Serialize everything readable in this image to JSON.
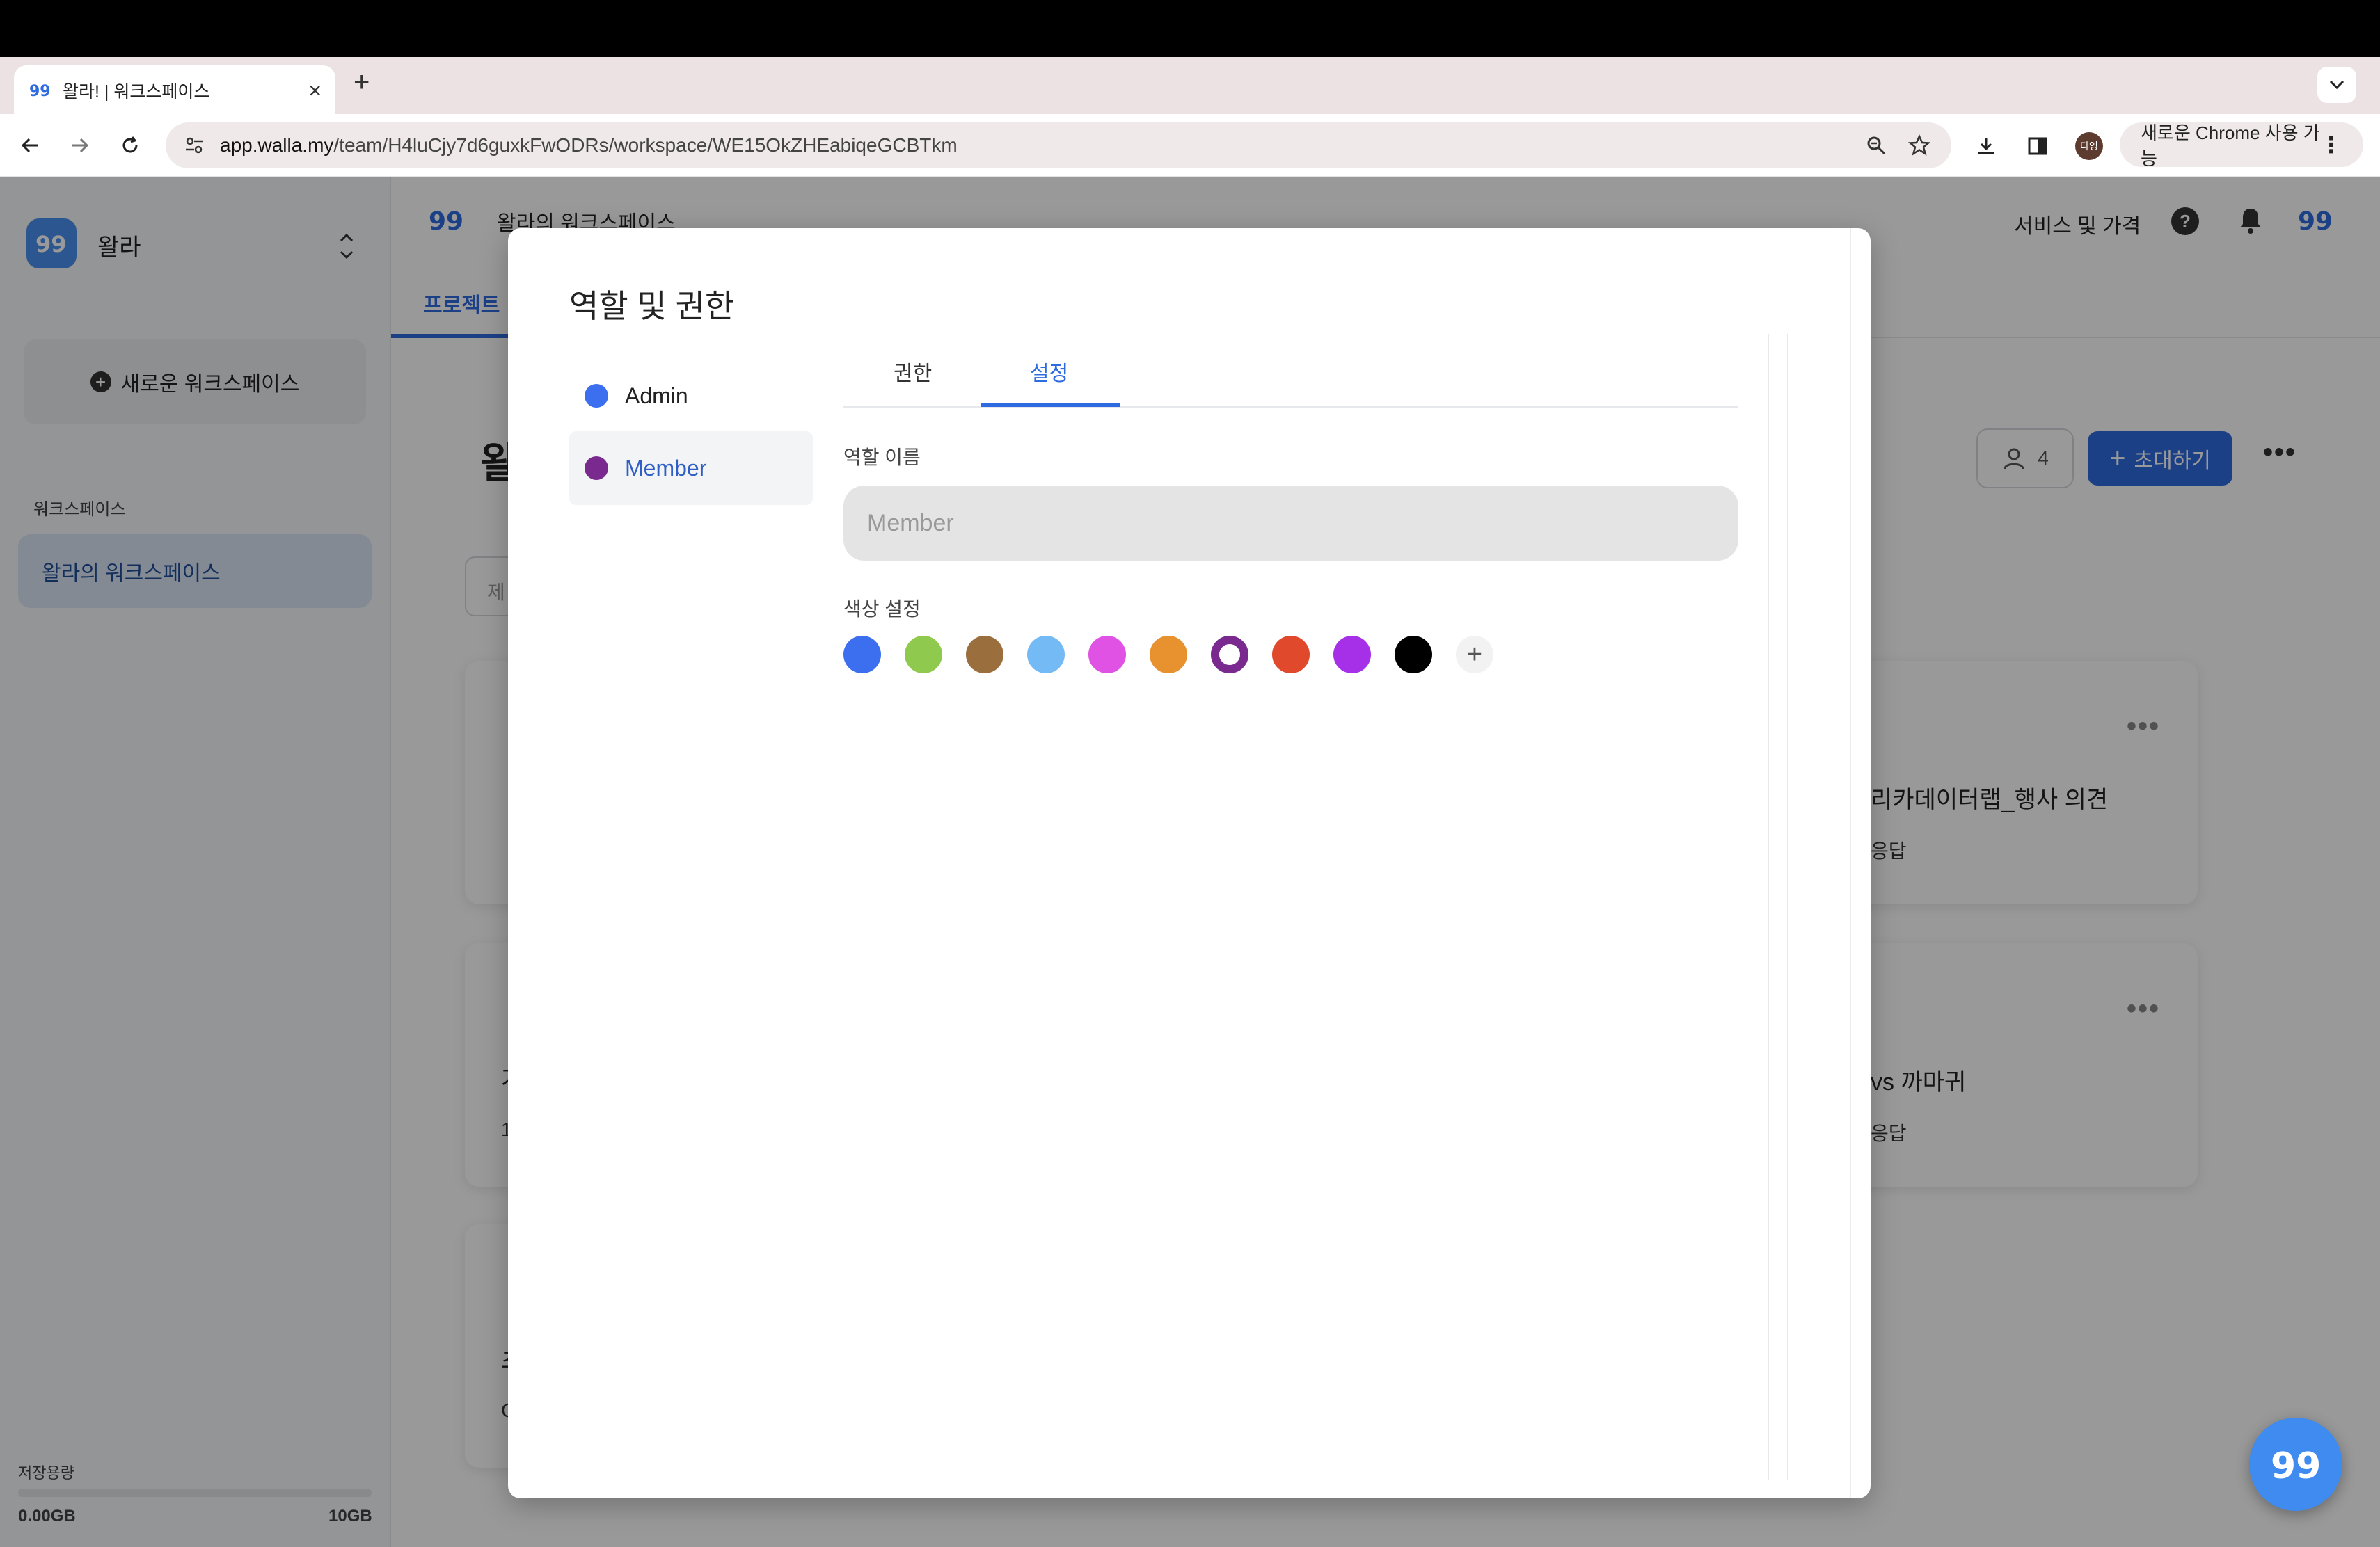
{
  "browser": {
    "tab_title": "왈라! | 워크스페이스",
    "url_host": "app.walla.my",
    "url_path": "/team/H4luCjy7d6guxkFwODRs/workspace/WE15OkZHEabiqeGCBTkm",
    "profile_initials": "다영",
    "chrome_button": "새로운 Chrome 사용 가능"
  },
  "sidebar": {
    "brand": "왈라",
    "new_workspace": "새로운 워크스페이스",
    "section_label": "워크스페이스",
    "workspace_item": "왈라의 워크스페이스",
    "storage_label": "저장용량",
    "storage_used": "0.00GB",
    "storage_max": "10GB"
  },
  "header": {
    "workspace_title": "왈라의 워크스페이스",
    "services_link": "서비스 및 가격",
    "help_glyph": "?"
  },
  "main": {
    "tab_projects": "프로젝트",
    "page_title": "왈",
    "filter_placeholder": "제",
    "member_count": "4",
    "invite_label": "초대하기",
    "cards": [
      {
        "title": "리카데이터랩_행사 의견",
        "sub": "응답"
      },
      {
        "title": "vs 까마귀",
        "sub": "응답"
      }
    ],
    "left_card_fragments": [
      "가",
      "1",
      "초",
      "C"
    ]
  },
  "modal": {
    "title": "역할 및 권한",
    "roles": [
      {
        "name": "Admin",
        "color": "#3b6ff0"
      },
      {
        "name": "Member",
        "color": "#7a2a8e"
      }
    ],
    "tabs": [
      "권한",
      "설정"
    ],
    "active_tab": "설정",
    "role_name_label": "역할 이름",
    "role_name_placeholder": "Member",
    "color_label": "색상 설정",
    "colors": [
      "#3b6ff0",
      "#8fc94e",
      "#9a6f3d",
      "#74bbf5",
      "#e052e3",
      "#e8912f",
      "#7a2a8e",
      "#e0492c",
      "#a62fe8",
      "#000000"
    ],
    "selected_color": "#7a2a8e",
    "add_color_glyph": "+"
  }
}
